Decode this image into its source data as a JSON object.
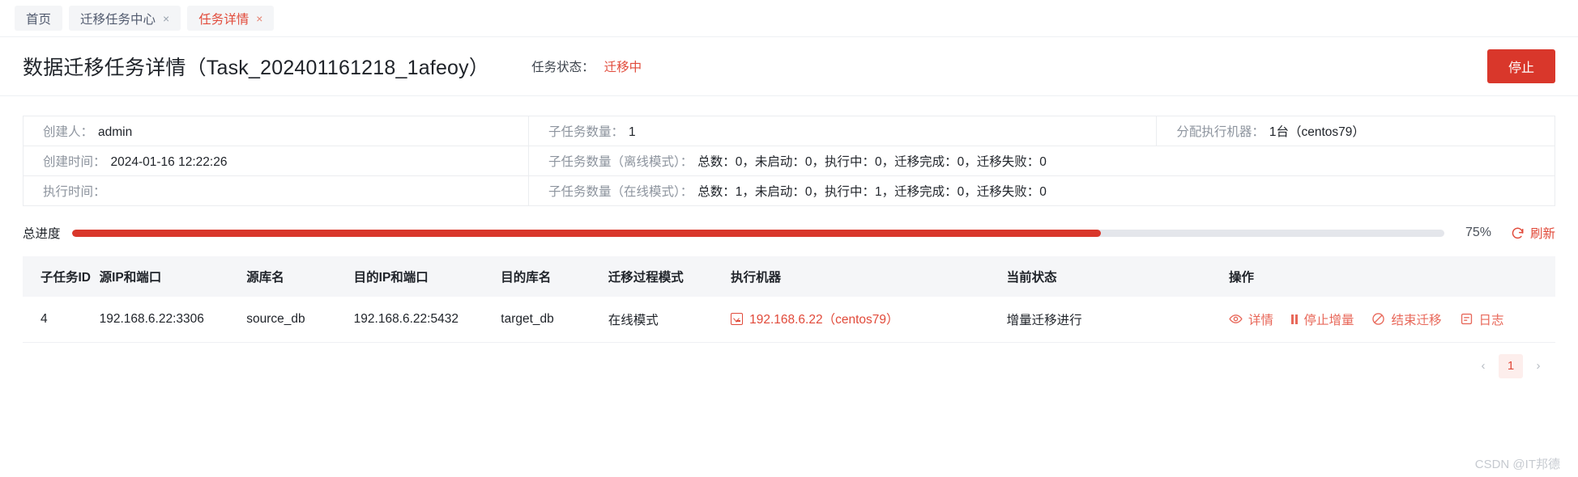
{
  "tabs": [
    {
      "label": "首页",
      "closable": false,
      "active": false
    },
    {
      "label": "迁移任务中心",
      "closable": true,
      "active": false,
      "close": "×"
    },
    {
      "label": "任务详情",
      "closable": true,
      "active": true,
      "close": "×"
    }
  ],
  "header": {
    "title": "数据迁移任务详情（Task_202401161218_1afeoy）",
    "status_label": "任务状态：",
    "status_value": "迁移中",
    "stop_button": "停止"
  },
  "info": {
    "rows": [
      {
        "a_label": "创建人：",
        "a_value": "admin",
        "b_label": "子任务数量：",
        "b_value": "1",
        "c_label": "分配执行机器：",
        "c_value": "1台（centos79）"
      },
      {
        "a_label": "创建时间：",
        "a_value": "2024-01-16 12:22:26",
        "b_label": "子任务数量（离线模式）：",
        "b_value": "总数：0，未启动：0，执行中：0，迁移完成：0，迁移失败：0",
        "c_label": "",
        "c_value": ""
      },
      {
        "a_label": "执行时间：",
        "a_value": "",
        "b_label": "子任务数量（在线模式）：",
        "b_value": "总数：1，未启动：0，执行中：1，迁移完成：0，迁移失败：0",
        "c_label": "",
        "c_value": ""
      }
    ]
  },
  "progress": {
    "label": "总进度",
    "percent_text": "75%",
    "percent_value": 75,
    "refresh_label": "刷新",
    "refresh_icon": "refresh-icon",
    "fill_color": "#d9372b",
    "track_color": "#e4e6eb"
  },
  "table": {
    "columns": [
      "子任务ID",
      "源IP和端口",
      "源库名",
      "目的IP和端口",
      "目的库名",
      "迁移过程模式",
      "执行机器",
      "当前状态",
      "操作"
    ],
    "rows": [
      {
        "id": "4",
        "source_ip": "192.168.6.22:3306",
        "source_db": "source_db",
        "target_ip": "192.168.6.22:5432",
        "target_db": "target_db",
        "mode": "在线模式",
        "machine_icon": "terminal-icon",
        "machine": "192.168.6.22（centos79）",
        "state": "增量迁移进行",
        "ops": [
          {
            "icon": "eye-icon",
            "label": "详情"
          },
          {
            "icon": "pause-icon",
            "label": "停止增量"
          },
          {
            "icon": "ban-icon",
            "label": "结束迁移"
          },
          {
            "icon": "log-icon",
            "label": "日志"
          }
        ]
      }
    ]
  },
  "pagination": {
    "prev": "‹",
    "current": "1",
    "next": "›"
  },
  "watermark": "CSDN @IT邦德",
  "colors": {
    "accent_red": "#e14a3a",
    "button_red": "#d9372b",
    "link_red": "#e8685a",
    "text_primary": "#1f2329",
    "text_muted": "#8d949e"
  }
}
